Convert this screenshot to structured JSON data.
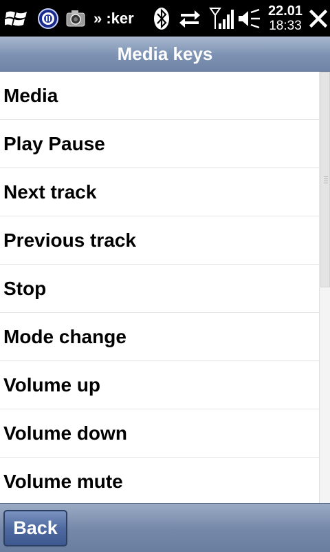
{
  "status_bar": {
    "app_name": "» :ker",
    "date": "22.01",
    "time": "18:33",
    "icons": [
      "windows-start-icon",
      "media-player-icon",
      "camera-icon",
      "bluetooth-icon",
      "data-sync-icon",
      "signal-strength-icon",
      "volume-muted-icon",
      "close-icon"
    ]
  },
  "header": {
    "title": "Media keys"
  },
  "list": {
    "items": [
      {
        "label": "Media"
      },
      {
        "label": "Play Pause"
      },
      {
        "label": "Next track"
      },
      {
        "label": "Previous track"
      },
      {
        "label": "Stop"
      },
      {
        "label": "Mode change"
      },
      {
        "label": "Volume up"
      },
      {
        "label": "Volume down"
      },
      {
        "label": "Volume mute"
      }
    ]
  },
  "scroll": {
    "visible_fraction": 0.5,
    "position_fraction": 0.0
  },
  "footer": {
    "back_label": "Back"
  },
  "colors": {
    "title_bar": "#7f94b4",
    "status_bar": "#000000",
    "button": "#4e6aa0"
  }
}
